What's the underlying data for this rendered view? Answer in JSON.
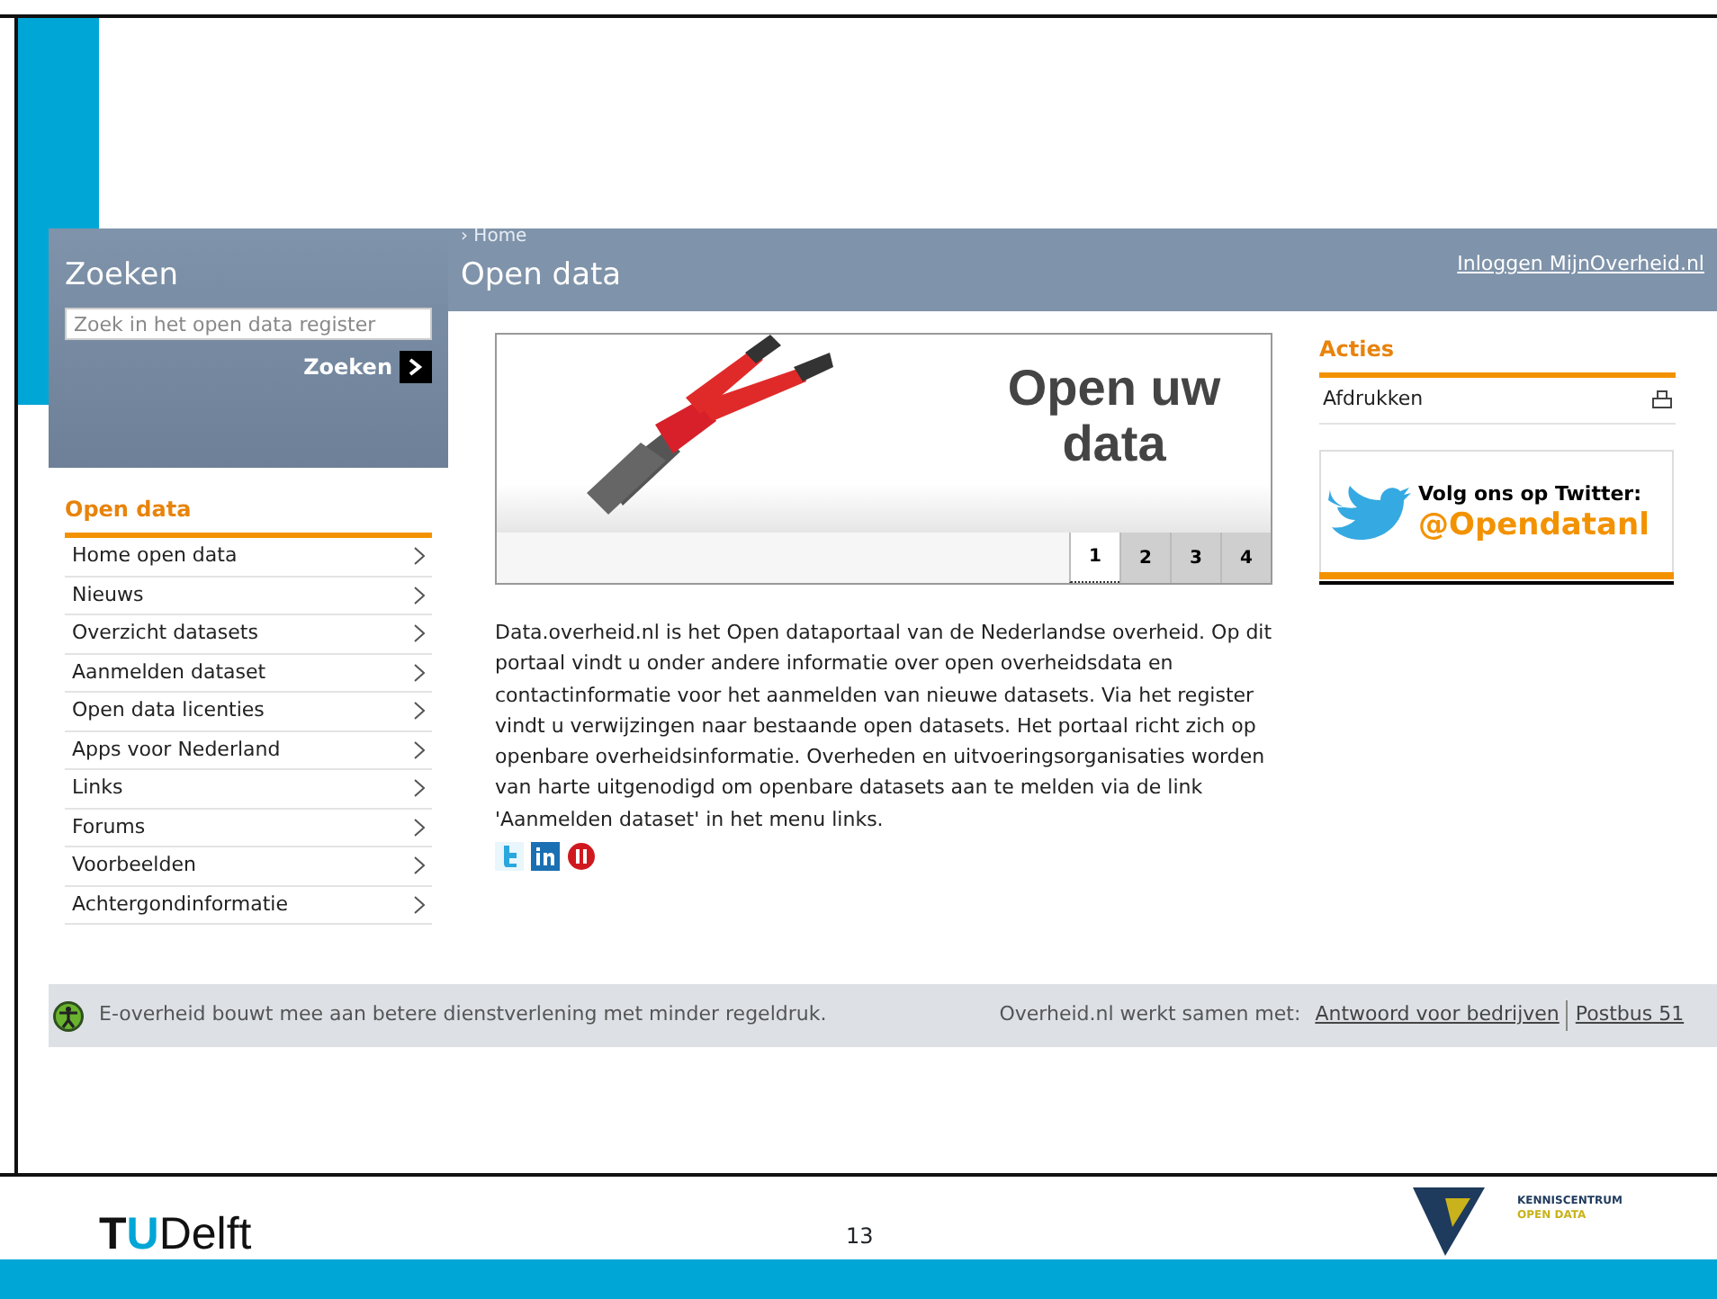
{
  "search": {
    "title": "Zoeken",
    "placeholder": "Zoek in het open data register",
    "button": "Zoeken"
  },
  "header": {
    "breadcrumb": "› Home",
    "title": "Open data",
    "login_link": "Inloggen MijnOverheid.nl"
  },
  "sidebar": {
    "heading": "Open data",
    "items": [
      {
        "label": "Home open data"
      },
      {
        "label": "Nieuws"
      },
      {
        "label": "Overzicht datasets"
      },
      {
        "label": "Aanmelden dataset"
      },
      {
        "label": "Open data licenties"
      },
      {
        "label": "Apps voor Nederland"
      },
      {
        "label": "Links"
      },
      {
        "label": "Forums"
      },
      {
        "label": "Voorbeelden"
      },
      {
        "label": "Achtergondinformatie"
      }
    ]
  },
  "banner": {
    "headline": "Open uw data",
    "pages": [
      {
        "label": "1",
        "selected": true
      },
      {
        "label": "2",
        "selected": false
      },
      {
        "label": "3",
        "selected": false
      },
      {
        "label": "4",
        "selected": false
      }
    ]
  },
  "intro": "Data.overheid.nl is het Open dataportaal van de Nederlandse overheid. Op dit portaal vindt u onder andere informatie over open overheidsdata en contactinformatie voor het aanmelden van nieuwe datasets. Via het register vindt u verwijzingen naar bestaande open datasets. Het portaal richt zich op openbare overheidsinformatie. Overheden en uitvoeringsorganisaties worden van harte uitgenodigd om openbare datasets aan te melden via de link 'Aanmelden dataset' in het menu links.",
  "actions": {
    "heading": "Acties",
    "items": [
      {
        "label": "Afdrukken"
      }
    ]
  },
  "twitter": {
    "line": "Volg ons op Twitter:",
    "handle": "@Opendatanl"
  },
  "footer": {
    "slogan": "E-overheid bouwt mee aan betere dienstverlening met minder regeldruk.",
    "partners_label": "Overheid.nl werkt samen met:",
    "links": [
      "Antwoord voor bedrijven",
      "Postbus 51"
    ]
  },
  "slide": {
    "logo_parts": [
      "T",
      "U",
      "Delft"
    ],
    "page_number": "13",
    "partner_logo": [
      "KENNISCENTRUM",
      "OPEN DATA"
    ]
  }
}
